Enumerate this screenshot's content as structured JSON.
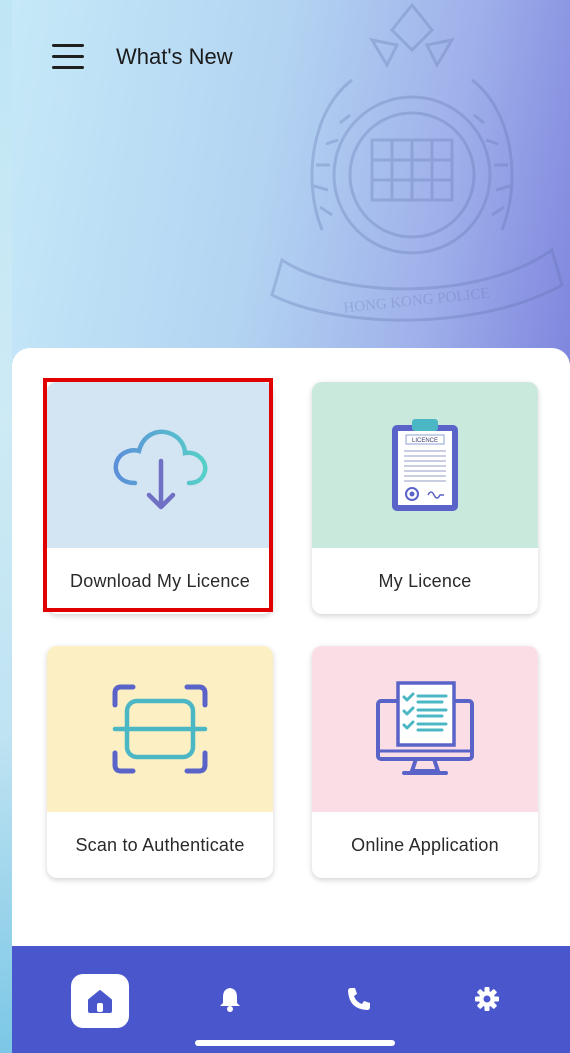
{
  "header": {
    "title": "What's New",
    "menu_icon": "hamburger-menu-icon",
    "background_emblem": "hong-kong-police-emblem",
    "emblem_ribbon_text": "HONG KONG POLICE"
  },
  "tiles": [
    {
      "label": "Download My Licence",
      "icon": "cloud-download-icon",
      "bg": "#d3e4f3",
      "highlighted": true
    },
    {
      "label": "My Licence",
      "icon": "licence-clipboard-icon",
      "bg": "#c9e9dd",
      "badge_text": "LICENCE"
    },
    {
      "label": "Scan to Authenticate",
      "icon": "scan-frame-icon",
      "bg": "#fcefc4"
    },
    {
      "label": "Online Application",
      "icon": "monitor-checklist-icon",
      "bg": "#fbdde6"
    }
  ],
  "bottom_nav": {
    "bg": "#4a57cc",
    "items": [
      {
        "icon": "home-icon",
        "active": true
      },
      {
        "icon": "bell-icon",
        "active": false
      },
      {
        "icon": "phone-icon",
        "active": false
      },
      {
        "icon": "gear-icon",
        "active": false
      }
    ]
  },
  "colors": {
    "highlight": "#e10000",
    "accent_teal": "#4bb7c4",
    "accent_indigo": "#5a63c8"
  }
}
